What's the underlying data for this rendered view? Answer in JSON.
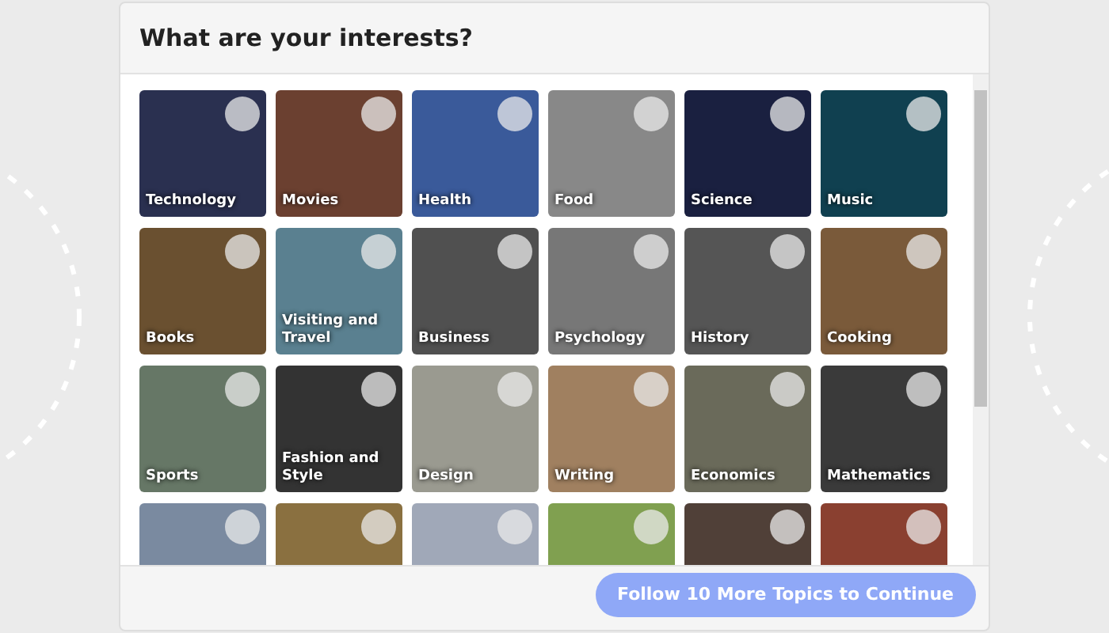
{
  "dialog": {
    "title": "What are your interests?"
  },
  "topics": [
    {
      "label": "Technology",
      "selected": false
    },
    {
      "label": "Movies",
      "selected": false
    },
    {
      "label": "Health",
      "selected": false
    },
    {
      "label": "Food",
      "selected": false
    },
    {
      "label": "Science",
      "selected": false
    },
    {
      "label": "Music",
      "selected": false
    },
    {
      "label": "Books",
      "selected": false
    },
    {
      "label": "Visiting and Travel",
      "selected": false
    },
    {
      "label": "Business",
      "selected": false
    },
    {
      "label": "Psychology",
      "selected": false
    },
    {
      "label": "History",
      "selected": false
    },
    {
      "label": "Cooking",
      "selected": false
    },
    {
      "label": "Sports",
      "selected": false
    },
    {
      "label": "Fashion and Style",
      "selected": false
    },
    {
      "label": "Design",
      "selected": false
    },
    {
      "label": "Writing",
      "selected": false
    },
    {
      "label": "Economics",
      "selected": false
    },
    {
      "label": "Mathematics",
      "selected": false
    },
    {
      "selected": false
    },
    {
      "selected": false
    },
    {
      "selected": false
    },
    {
      "selected": false
    },
    {
      "selected": false
    },
    {
      "selected": false
    }
  ],
  "continue_button": {
    "label": "Follow 10 More Topics to Continue",
    "disabled": true
  }
}
